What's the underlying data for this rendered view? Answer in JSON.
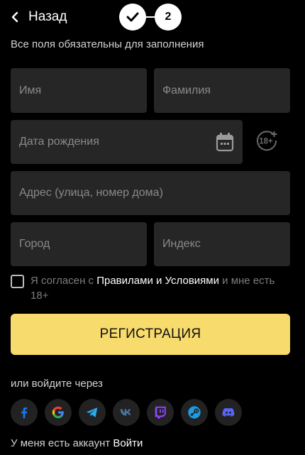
{
  "header": {
    "back_label": "Назад",
    "steps": [
      {
        "state": "completed",
        "icon": "check-icon"
      },
      {
        "state": "current",
        "label": "2"
      }
    ]
  },
  "subtitle": "Все поля обязательны для заполнения",
  "form": {
    "first_name": {
      "placeholder": "Имя",
      "value": ""
    },
    "last_name": {
      "placeholder": "Фамилия",
      "value": ""
    },
    "birth_date": {
      "placeholder": "Дата рождения",
      "value": "",
      "icon": "calendar-icon"
    },
    "age_badge": {
      "label": "18+",
      "icon": "age-restriction-icon"
    },
    "address": {
      "placeholder": "Адрес (улица, номер дома)",
      "value": ""
    },
    "city": {
      "placeholder": "Город",
      "value": ""
    },
    "postcode": {
      "placeholder": "Индекс",
      "value": ""
    }
  },
  "agreement": {
    "checked": false,
    "prefix": "Я согласен с ",
    "link": "Правилами и Условиями",
    "suffix": " и мне есть 18+"
  },
  "register_button": "РЕГИСТРАЦИЯ",
  "social": {
    "label": "или войдите через",
    "providers": [
      {
        "name": "Facebook",
        "icon": "facebook-icon",
        "color": "#1877f2"
      },
      {
        "name": "Google",
        "icon": "google-icon",
        "color": "#ea4335"
      },
      {
        "name": "Telegram",
        "icon": "telegram-icon",
        "color": "#2aabee"
      },
      {
        "name": "VK",
        "icon": "vk-icon",
        "color": "#4c75a3"
      },
      {
        "name": "Twitch",
        "icon": "twitch-icon",
        "color": "#9146ff"
      },
      {
        "name": "Steam",
        "icon": "steam-icon",
        "color": "#1b9ce5"
      },
      {
        "name": "Discord",
        "icon": "discord-icon",
        "color": "#5865f2"
      }
    ]
  },
  "footer": {
    "text": "У меня есть аккаунт",
    "login_link": "Войти"
  },
  "colors": {
    "background": "#000000",
    "field": "#262626",
    "accent": "#f8db6d",
    "muted_text": "#8a8a8a"
  }
}
